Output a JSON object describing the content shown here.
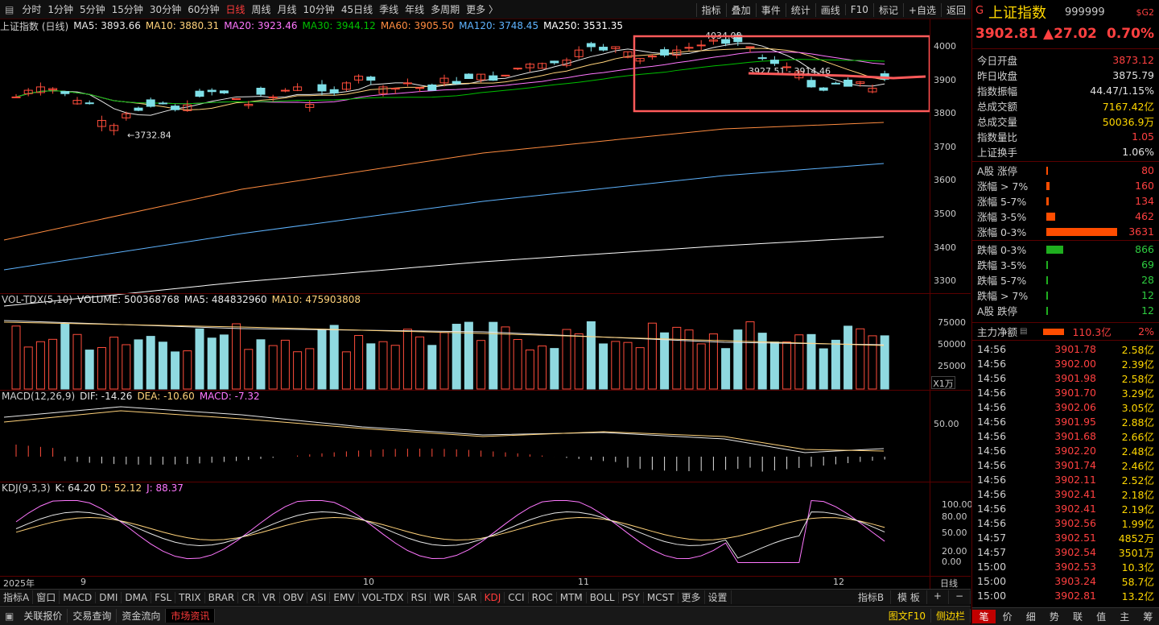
{
  "topbar": {
    "tabs": [
      "分时",
      "1分钟",
      "5分钟",
      "15分钟",
      "30分钟",
      "60分钟",
      "日线",
      "周线",
      "月线",
      "10分钟",
      "45日线",
      "季线",
      "年线",
      "多周期",
      "更多 〉"
    ],
    "active_tab": "日线",
    "right_buttons": [
      "指标",
      "叠加",
      "事件",
      "统计",
      "画线",
      "F10",
      "标记",
      "+自选",
      "返回"
    ]
  },
  "main_legend": {
    "title": "上证指数 (日线)",
    "ma5": "MA5: 3893.66",
    "ma10": "MA10: 3880.31",
    "ma20": "MA20: 3923.46",
    "ma30": "MA30: 3944.12",
    "ma60": "MA60: 3905.50",
    "ma120": "MA120: 3748.45",
    "ma250": "MA250: 3531.35"
  },
  "main_axis": [
    "4000",
    "3900",
    "3800",
    "3700",
    "3600",
    "3500",
    "3400",
    "3300"
  ],
  "annotations": {
    "high": "4034.08",
    "low": "3732.84",
    "mid": "3927.51 - 3914.46"
  },
  "vol_legend": {
    "title": "VOL-TDX(5,10)",
    "volume": "VOLUME: 500368768",
    "ma5": "MA5: 484832960",
    "ma10": "MA10: 475903808"
  },
  "vol_axis": [
    "75000",
    "50000",
    "25000"
  ],
  "vol_unit": "X1万",
  "macd_legend": {
    "title": "MACD(12,26,9)",
    "dif": "DIF: -14.26",
    "dea": "DEA: -10.60",
    "macd": "MACD: -7.32"
  },
  "macd_axis": [
    "50.00"
  ],
  "kdj_legend": {
    "title": "KDJ(9,3,3)",
    "k": "K: 64.20",
    "d": "D: 52.12",
    "j": "J: 88.37"
  },
  "kdj_axis": [
    "100.00",
    "80.00",
    "50.00",
    "20.00",
    "0.00"
  ],
  "date_axis": {
    "year": "2025年",
    "months": [
      "9",
      "10",
      "11",
      "12"
    ],
    "period": "日线"
  },
  "indicator_bar": {
    "left": "指标A",
    "items": [
      "窗口",
      "MACD",
      "DMI",
      "DMA",
      "FSL",
      "TRIX",
      "BRAR",
      "CR",
      "VR",
      "OBV",
      "ASI",
      "EMV",
      "VOL-TDX",
      "RSI",
      "WR",
      "SAR",
      "KDJ",
      "CCI",
      "ROC",
      "MTM",
      "BOLL",
      "PSY",
      "MCST",
      "更多",
      "设置"
    ],
    "active": "KDJ",
    "right": [
      "指标B",
      "模 板",
      "+",
      "−"
    ]
  },
  "statusbar": {
    "items": [
      "关联报价",
      "交易查询",
      "资金流向",
      "市场资讯"
    ],
    "active": "市场资讯",
    "right": [
      "图文F10",
      "侧边栏"
    ]
  },
  "quote": {
    "code_prefix": "G",
    "name": "上证指数",
    "code": "999999",
    "badge": "$G2",
    "price": "3902.81",
    "change": "▲27.02",
    "pct": "0.70%",
    "stats": [
      {
        "label": "今日开盘",
        "value": "3873.12",
        "color": "red"
      },
      {
        "label": "昨日收盘",
        "value": "3875.79",
        "color": "white"
      },
      {
        "label": "指数振幅",
        "value": "44.47/1.15%",
        "color": "white"
      },
      {
        "label": "总成交额",
        "value": "7167.42亿",
        "color": "yellow"
      },
      {
        "label": "总成交量",
        "value": "50036.9万",
        "color": "yellow"
      },
      {
        "label": "指数量比",
        "value": "1.05",
        "color": "red"
      },
      {
        "label": "上证换手",
        "value": "1.06%",
        "color": "white"
      }
    ],
    "breadth": [
      {
        "label": "A股 涨停",
        "value": "80",
        "color": "red",
        "bar": 0.02
      },
      {
        "label": "涨幅 > 7%",
        "value": "160",
        "color": "red",
        "bar": 0.04
      },
      {
        "label": "涨幅 5-7%",
        "value": "134",
        "color": "red",
        "bar": 0.035
      },
      {
        "label": "涨幅 3-5%",
        "value": "462",
        "color": "red",
        "bar": 0.12
      },
      {
        "label": "涨幅 0-3%",
        "value": "3631",
        "color": "red",
        "bar": 1.0
      },
      {
        "label": "跌幅 0-3%",
        "value": "866",
        "color": "green",
        "bar": 0.24
      },
      {
        "label": "跌幅 3-5%",
        "value": "69",
        "color": "green",
        "bar": 0.02
      },
      {
        "label": "跌幅 5-7%",
        "value": "28",
        "color": "green",
        "bar": 0.01
      },
      {
        "label": "跌幅 > 7%",
        "value": "12",
        "color": "green",
        "bar": 0.005
      },
      {
        "label": "A股 跌停",
        "value": "12",
        "color": "green",
        "bar": 0.005
      }
    ],
    "main_flow": {
      "label": "主力净额",
      "value": "110.3亿",
      "pct": "2%"
    },
    "ticks": [
      [
        "14:56",
        "3901.78",
        "2.58亿"
      ],
      [
        "14:56",
        "3902.00",
        "2.39亿"
      ],
      [
        "14:56",
        "3901.98",
        "2.58亿"
      ],
      [
        "14:56",
        "3901.70",
        "3.29亿"
      ],
      [
        "14:56",
        "3902.06",
        "3.05亿"
      ],
      [
        "14:56",
        "3901.95",
        "2.88亿"
      ],
      [
        "14:56",
        "3901.68",
        "2.66亿"
      ],
      [
        "14:56",
        "3902.20",
        "2.48亿"
      ],
      [
        "14:56",
        "3901.74",
        "2.46亿"
      ],
      [
        "14:56",
        "3902.11",
        "2.52亿"
      ],
      [
        "14:56",
        "3902.41",
        "2.18亿"
      ],
      [
        "14:56",
        "3902.41",
        "2.19亿"
      ],
      [
        "14:56",
        "3902.56",
        "1.99亿"
      ],
      [
        "14:57",
        "3902.51",
        "4852万"
      ],
      [
        "14:57",
        "3902.54",
        "3501万"
      ],
      [
        "15:00",
        "3902.53",
        "10.3亿"
      ],
      [
        "15:00",
        "3903.24",
        "58.7亿"
      ],
      [
        "15:00",
        "3902.81",
        "13.2亿"
      ]
    ],
    "tabs": [
      "笔",
      "价",
      "细",
      "势",
      "联",
      "值",
      "主",
      "筹"
    ],
    "active_tab": "笔"
  }
}
